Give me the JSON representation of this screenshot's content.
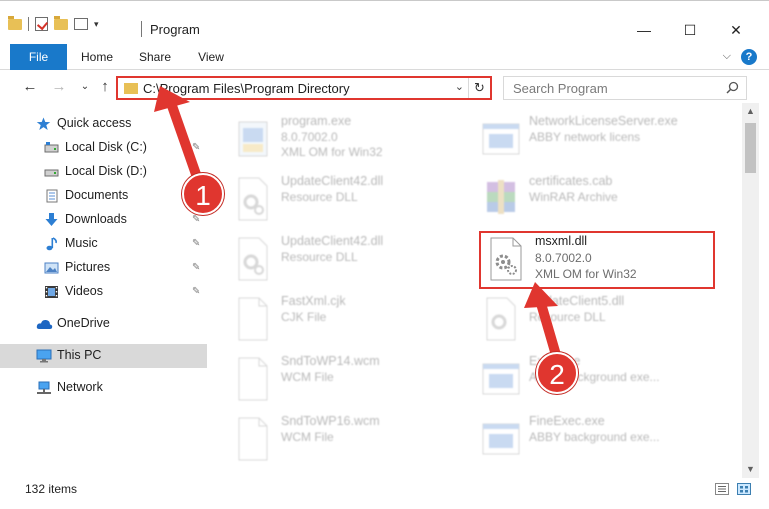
{
  "window": {
    "title": "Program",
    "minimize": "—",
    "maximize": "☐",
    "close": "✕"
  },
  "ribbon": {
    "tabs": [
      "File",
      "Home",
      "Share",
      "View"
    ],
    "help": "?"
  },
  "address": {
    "path": "C:\\Program Files\\Program Directory",
    "refresh": "↻"
  },
  "search": {
    "placeholder": "Search Program"
  },
  "nav_pane": {
    "items": [
      {
        "label": "Quick access",
        "icon": "star-icon"
      },
      {
        "label": "Local Disk (C:)",
        "icon": "drive-icon",
        "pinned": true
      },
      {
        "label": "Local Disk (D:)",
        "icon": "drive-icon",
        "pinned": true
      },
      {
        "label": "Documents",
        "icon": "documents-icon",
        "pinned": true
      },
      {
        "label": "Downloads",
        "icon": "downloads-icon",
        "pinned": true
      },
      {
        "label": "Music",
        "icon": "music-icon",
        "pinned": true
      },
      {
        "label": "Pictures",
        "icon": "pictures-icon",
        "pinned": true
      },
      {
        "label": "Videos",
        "icon": "videos-icon",
        "pinned": true
      },
      {
        "label": "OneDrive",
        "icon": "cloud-icon"
      },
      {
        "label": "This PC",
        "icon": "pc-icon",
        "selected": true
      },
      {
        "label": "Network",
        "icon": "network-icon"
      }
    ]
  },
  "files": {
    "left": [
      {
        "name": "program.exe",
        "line1": "8.0.7002.0",
        "line2": "XML OM for Win32"
      },
      {
        "name": "UpdateClient42.dll",
        "line1": "Resource DLL",
        "line2": ""
      },
      {
        "name": "UpdateClient42.dll",
        "line1": "Resource DLL",
        "line2": ""
      },
      {
        "name": "FastXml.cjk",
        "line1": "CJK File",
        "line2": ""
      },
      {
        "name": "SndToWP14.wcm",
        "line1": "WCM File",
        "line2": ""
      },
      {
        "name": "SndToWP16.wcm",
        "line1": "WCM File",
        "line2": ""
      }
    ],
    "right": [
      {
        "name": "NetworkLicenseServer.exe",
        "line1": "ABBY network licens",
        "line2": ""
      },
      {
        "name": "certificates.cab",
        "line1": "WinRAR Archive",
        "line2": ""
      },
      {
        "name": "msxml.dll",
        "line1": "8.0.7002.0",
        "line2": "XML OM for Win32"
      },
      {
        "name": "UpdateClient5.dll",
        "line1": "Resource DLL",
        "line2": ""
      },
      {
        "name": "Exec.exe",
        "line1": "ABBY background exe...",
        "line2": ""
      },
      {
        "name": "FineExec.exe",
        "line1": "ABBY background exe...",
        "line2": ""
      }
    ]
  },
  "status": {
    "count": "132 items"
  },
  "callouts": [
    "1",
    "2"
  ],
  "colors": {
    "accent": "#1979ca",
    "highlight": "#e0362f",
    "selected": "#d9d9d9"
  }
}
